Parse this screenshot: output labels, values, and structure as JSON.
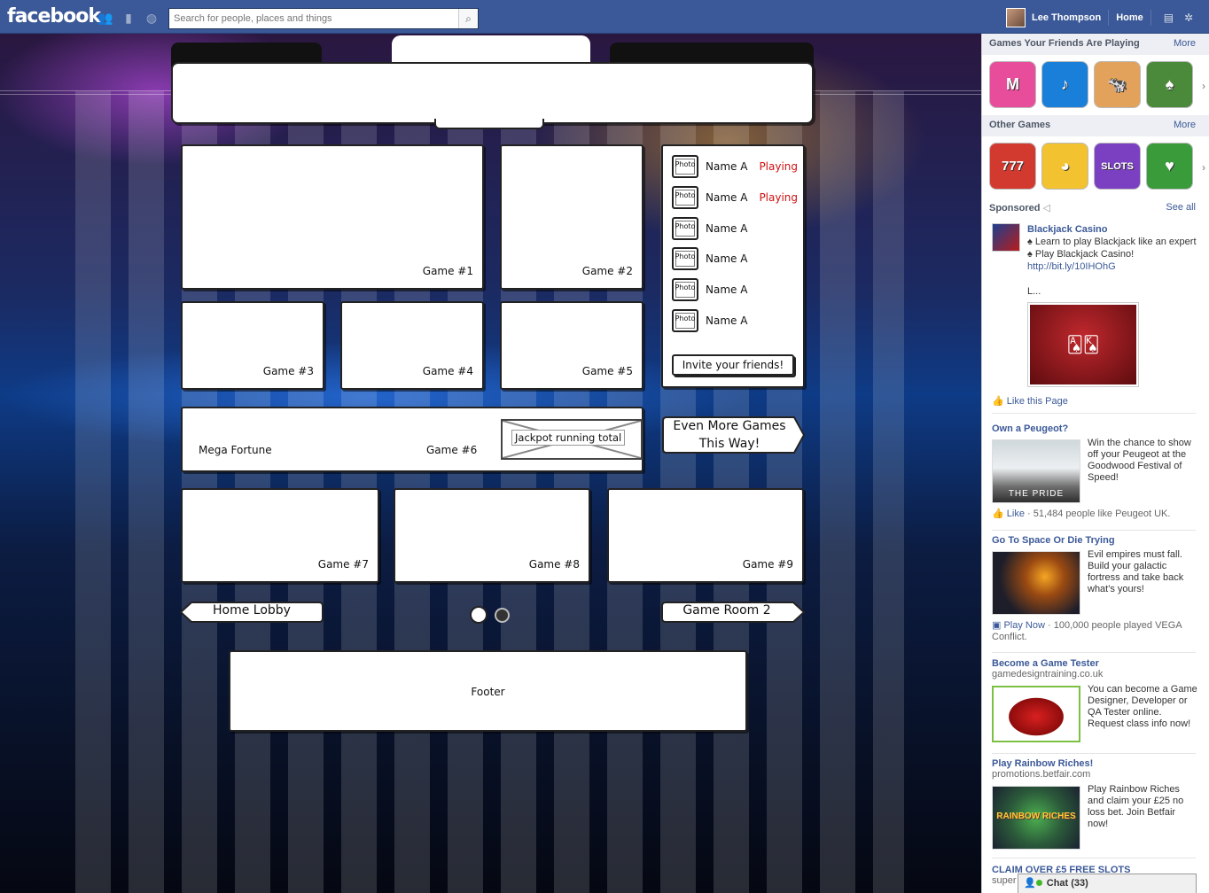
{
  "topbar": {
    "logo": "facebook",
    "search_placeholder": "Search for people, places and things",
    "user_name": "Lee Thompson",
    "home_label": "Home"
  },
  "game": {
    "tiles": [
      {
        "label": "Game #1"
      },
      {
        "label": "Game #2"
      },
      {
        "label": "Game #3"
      },
      {
        "label": "Game #4"
      },
      {
        "label": "Game #5"
      },
      {
        "label": "Game #6"
      },
      {
        "label": "Game #7"
      },
      {
        "label": "Game #8"
      },
      {
        "label": "Game #9"
      }
    ],
    "mega_fortune": "Mega Fortune",
    "jackpot_label": "Jackpot running total",
    "friends": [
      {
        "photo": "Photo",
        "name": "Name A",
        "status": "Playing"
      },
      {
        "photo": "Photo",
        "name": "Name A",
        "status": "Playing"
      },
      {
        "photo": "Photo",
        "name": "Name A",
        "status": ""
      },
      {
        "photo": "Photo",
        "name": "Name A",
        "status": ""
      },
      {
        "photo": "Photo",
        "name": "Name A",
        "status": ""
      },
      {
        "photo": "Photo",
        "name": "Name A",
        "status": ""
      }
    ],
    "invite_label": "Invite your friends!",
    "more_games_line1": "Even More Games",
    "more_games_line2": "This Way!",
    "home_lobby": "Home Lobby",
    "game_room_2": "Game Room 2",
    "footer": "Footer"
  },
  "sidebar": {
    "friends_playing_title": "Games Your Friends Are Playing",
    "more_label": "More",
    "friends_games": [
      {
        "label": "M",
        "color": "#e84d9b"
      },
      {
        "label": "♪",
        "color": "#1a7fd8"
      },
      {
        "label": "🐄",
        "color": "#e3a25b"
      },
      {
        "label": "♠",
        "color": "#4b8a3a"
      }
    ],
    "other_games_title": "Other Games",
    "other_games": [
      {
        "label": "777",
        "color": "#d33a2f"
      },
      {
        "label": "◕",
        "color": "#f2c230"
      },
      {
        "label": "SLOTS",
        "color": "#7b3fc1"
      },
      {
        "label": "♥",
        "color": "#3a9b3a"
      }
    ],
    "sponsored": "Sponsored",
    "see_all": "See all",
    "ads": [
      {
        "title": "Blackjack Casino",
        "text": "♠ Learn to play Blackjack like an expert ♠ Play Blackjack Casino!",
        "link": "http://bit.ly/10IHOhG",
        "ellipsis": "L...",
        "like": "Like this Page"
      },
      {
        "title": "Own a Peugeot?",
        "text": "Win the chance to show off your Peugeot at the Goodwood Festival of Speed!",
        "img_caption": "THE PRIDE",
        "like": "Like",
        "like_count": " · 51,484 people like Peugeot UK."
      },
      {
        "title": "Go To Space Or Die Trying",
        "text": "Evil empires must fall. Build your galactic fortress and take back what's yours!",
        "like": "Play Now",
        "like_count": " · 100,000 people played VEGA Conflict."
      },
      {
        "title": "Become a Game Tester",
        "domain": "gamedesigntraining.co.uk",
        "text": "You can become a Game Designer, Developer or QA Tester online. Request class info now!"
      },
      {
        "title": "Play Rainbow Riches!",
        "domain": "promotions.betfair.com",
        "text": "Play Rainbow Riches and claim your £25 no loss bet. Join Betfair now!",
        "img_caption": "RAINBOW RICHES"
      },
      {
        "title": "CLAIM OVER £5 FREE SLOTS",
        "domain": "super"
      }
    ],
    "chat_label": "Chat (33)"
  }
}
